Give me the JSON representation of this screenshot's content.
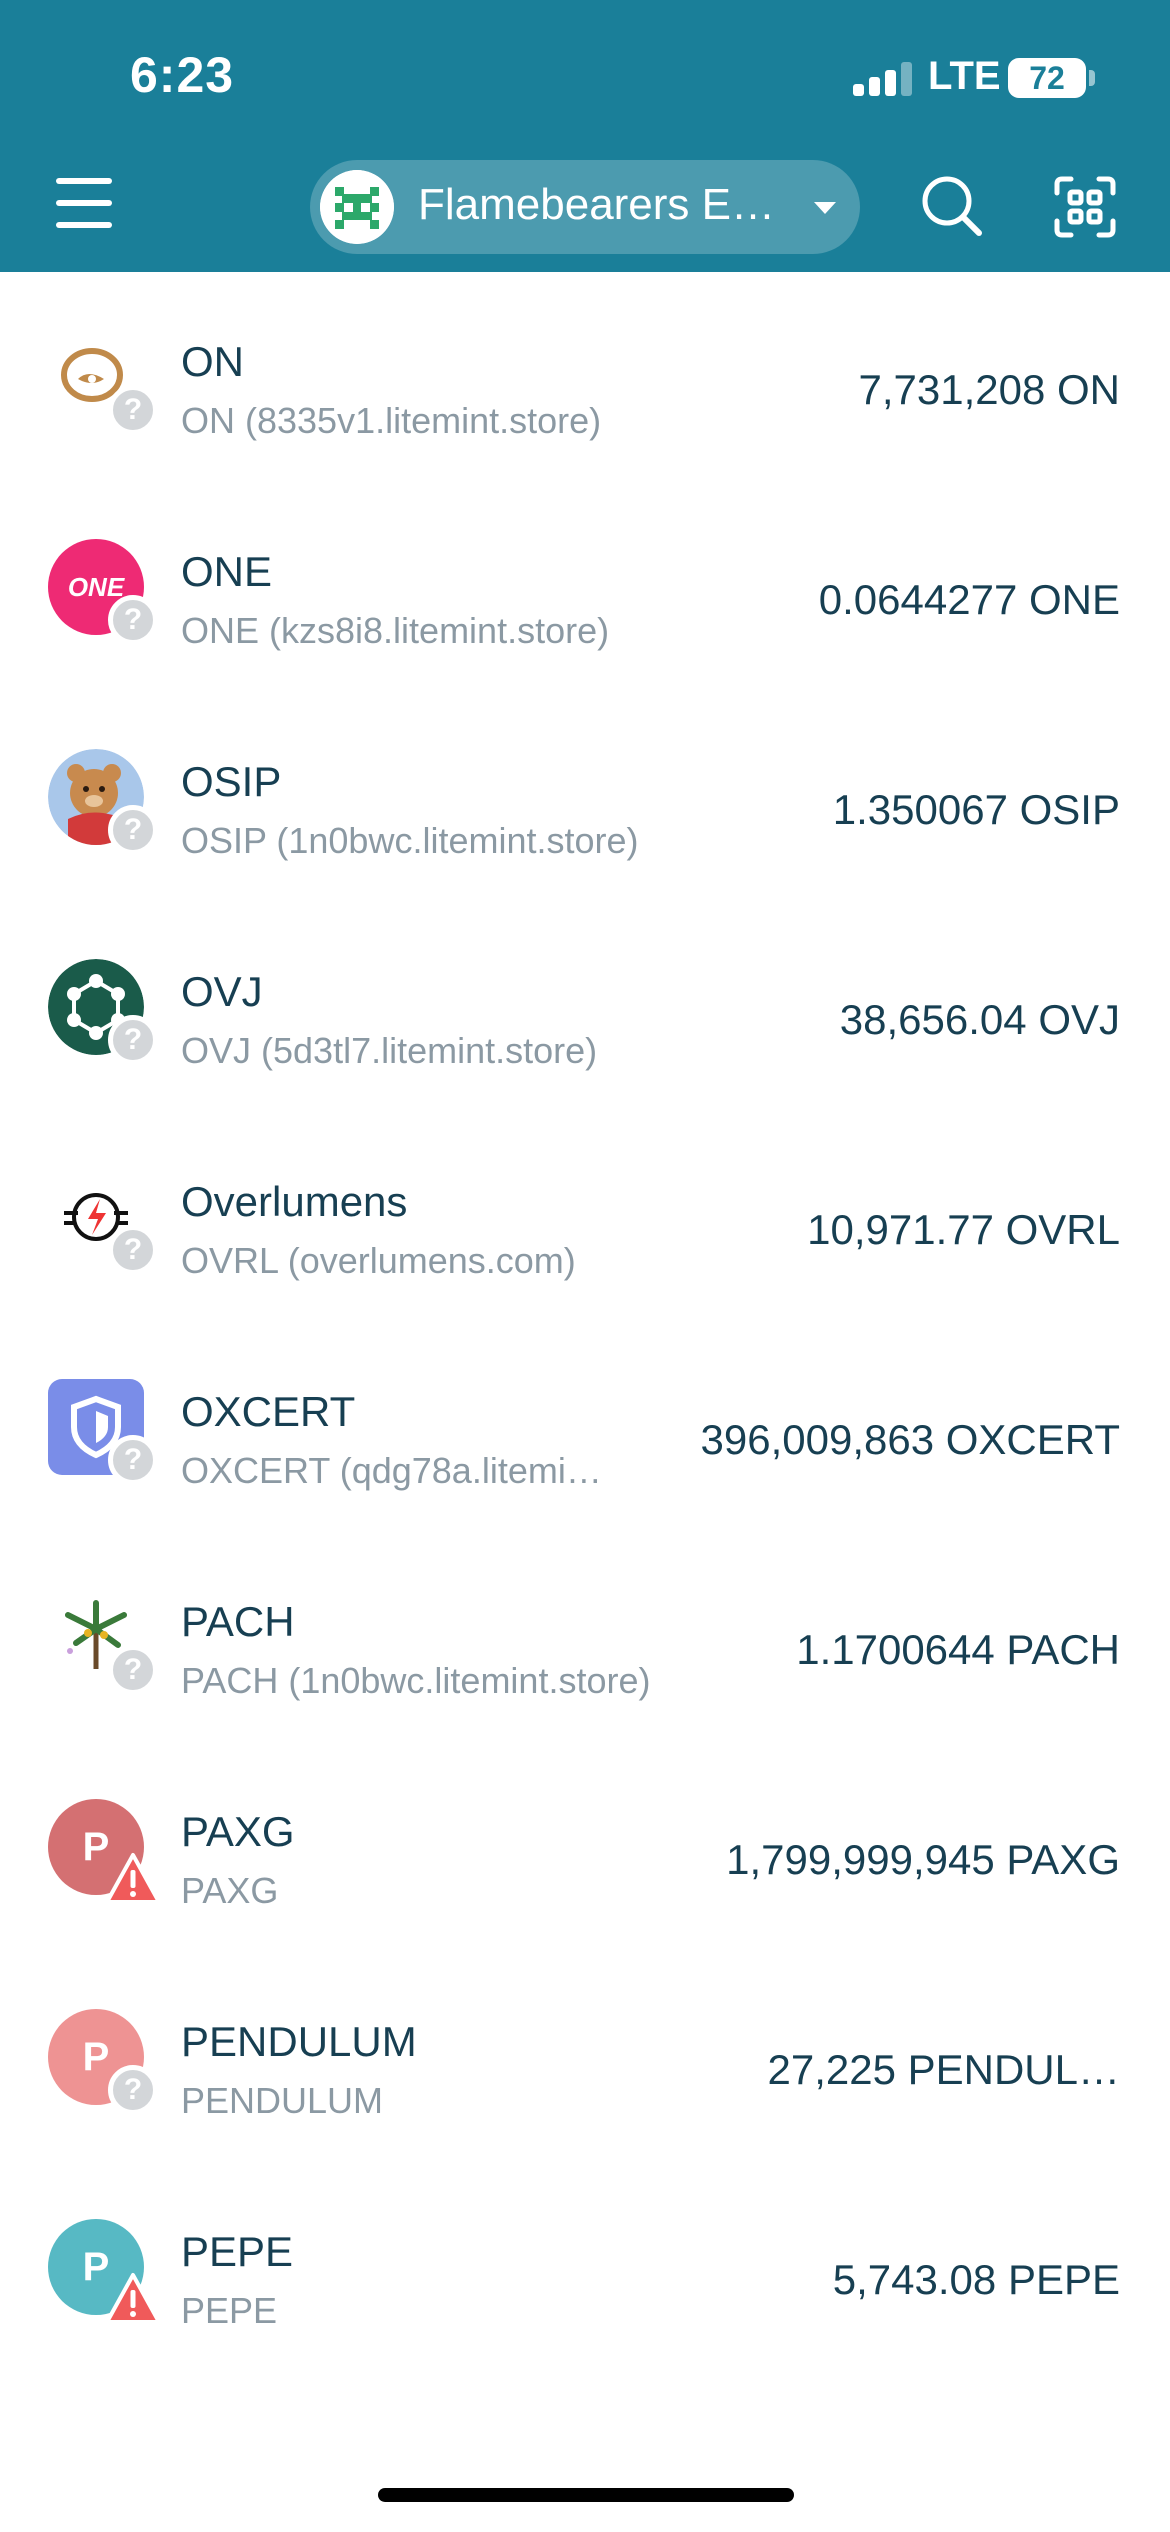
{
  "status_bar": {
    "time": "6:23",
    "network": "LTE",
    "battery": "72"
  },
  "header": {
    "account_name": "Flamebearers E…",
    "icons": {
      "menu": "hamburger-menu-icon",
      "search": "search-icon",
      "scan": "qr-scan-icon"
    }
  },
  "tokens": [
    {
      "name": "ON",
      "sub": "ON (8335v1.litemint.store)",
      "balance": "7,731,208 ON",
      "badge": "unknown"
    },
    {
      "name": "ONE",
      "sub": "ONE (kzs8i8.litemint.store)",
      "balance": "0.0644277 ONE",
      "badge": "unknown",
      "icon_text": "ONE"
    },
    {
      "name": "OSIP",
      "sub": "OSIP (1n0bwc.litemint.store)",
      "balance": "1.350067 OSIP",
      "badge": "unknown"
    },
    {
      "name": "OVJ",
      "sub": "OVJ (5d3tl7.litemint.store)",
      "balance": "38,656.04 OVJ",
      "badge": "unknown"
    },
    {
      "name": "Overlumens",
      "sub": "OVRL (overlumens.com)",
      "balance": "10,971.77 OVRL",
      "badge": "unknown"
    },
    {
      "name": "OXCERT",
      "sub": "OXCERT (qdg78a.litemi…",
      "balance": "396,009,863 OXCERT",
      "badge": "unknown"
    },
    {
      "name": "PACH",
      "sub": "PACH (1n0bwc.litemint.store)",
      "balance": "1.1700644 PACH",
      "badge": "unknown"
    },
    {
      "name": "PAXG",
      "sub": "PAXG",
      "balance": "1,799,999,945 PAXG",
      "badge": "warning",
      "icon_text": "P"
    },
    {
      "name": "PENDULUM",
      "sub": "PENDULUM",
      "balance": "27,225 PENDUL…",
      "badge": "unknown",
      "icon_text": "P"
    },
    {
      "name": "PEPE",
      "sub": "PEPE",
      "balance": "5,743.08 PEPE",
      "badge": "warning",
      "icon_text": "P"
    }
  ],
  "badge_glyph": "?",
  "colors": {
    "header": "#1a7f99",
    "text": "#173f52",
    "subtext": "#8b99a3",
    "warning": "#f05a5a"
  }
}
